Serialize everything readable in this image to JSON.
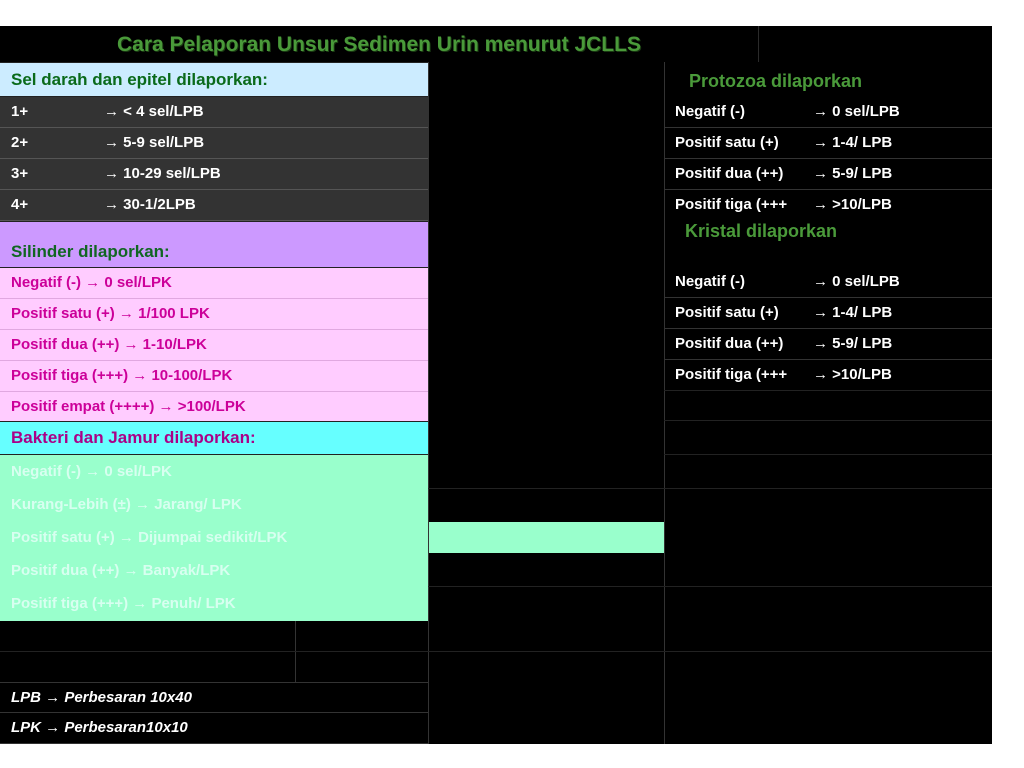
{
  "title": "Cara Pelaporan Unsur Sedimen Urin menurut JCLLS",
  "sel": {
    "header": "Sel darah dan epitel dilaporkan:",
    "rows": [
      {
        "k": "1+",
        "v": "→ < 4 sel/LPB"
      },
      {
        "k": "2+",
        "v": "→ 5-9 sel/LPB"
      },
      {
        "k": "3+",
        "v": "→ 10-29 sel/LPB"
      },
      {
        "k": "4+",
        "v": "→ 30-1/2LPB"
      }
    ]
  },
  "silinder": {
    "header": "Silinder dilaporkan:",
    "rows": [
      "Negatif (-)      → 0 sel/LPK",
      "Positif satu (+)     → 1/100 LPK",
      "Positif dua  (++)   → 1-10/LPK",
      "Positif tiga (+++)  → 10-100/LPK",
      "Positif empat (++++) → >100/LPK"
    ]
  },
  "bakteri": {
    "header": "Bakteri dan Jamur dilaporkan:",
    "rows": [
      "Negatif (-)       → 0 sel/LPK",
      "Kurang-Lebih (±)  → Jarang/ LPK",
      "Positif satu  (+)     → Dijumpai sedikit/LPK",
      "Positif dua (++)     → Banyak/LPK",
      "Positif tiga (+++)   → Penuh/ LPK"
    ]
  },
  "protozoa": {
    "header": "Protozoa dilaporkan",
    "rows": [
      {
        "k": "Negatif (-)",
        "v": "→ 0 sel/LPB"
      },
      {
        "k": "Positif satu (+)",
        "v": "→ 1-4/ LPB"
      },
      {
        "k": "Positif dua  (++)",
        "v": "→ 5-9/ LPB"
      },
      {
        "k": "Positif tiga (+++",
        "v": "→ >10/LPB"
      }
    ]
  },
  "kristal": {
    "header": "Kristal dilaporkan",
    "rows": [
      {
        "k": "Negatif (-)",
        "v": "→ 0 sel/LPB"
      },
      {
        "k": "Positif satu (+)",
        "v": "→ 1-4/ LPB"
      },
      {
        "k": "Positif dua  (++)",
        "v": "→ 5-9/ LPB"
      },
      {
        "k": "Positif tiga (+++",
        "v": "→ >10/LPB"
      }
    ]
  },
  "notes": [
    "LPB → Perbesaran 10x40",
    "LPK → Perbesaran10x10"
  ],
  "colors": {
    "title": "#4a9a3a",
    "sel_header_bg": "#ccecff",
    "silinder_header_bg": "#cc99ff",
    "silinder_bg": "#ffccff",
    "bakteri_header_bg": "#66ffff",
    "bakteri_bg": "#99ffcc",
    "pink_text": "#cc0099"
  }
}
